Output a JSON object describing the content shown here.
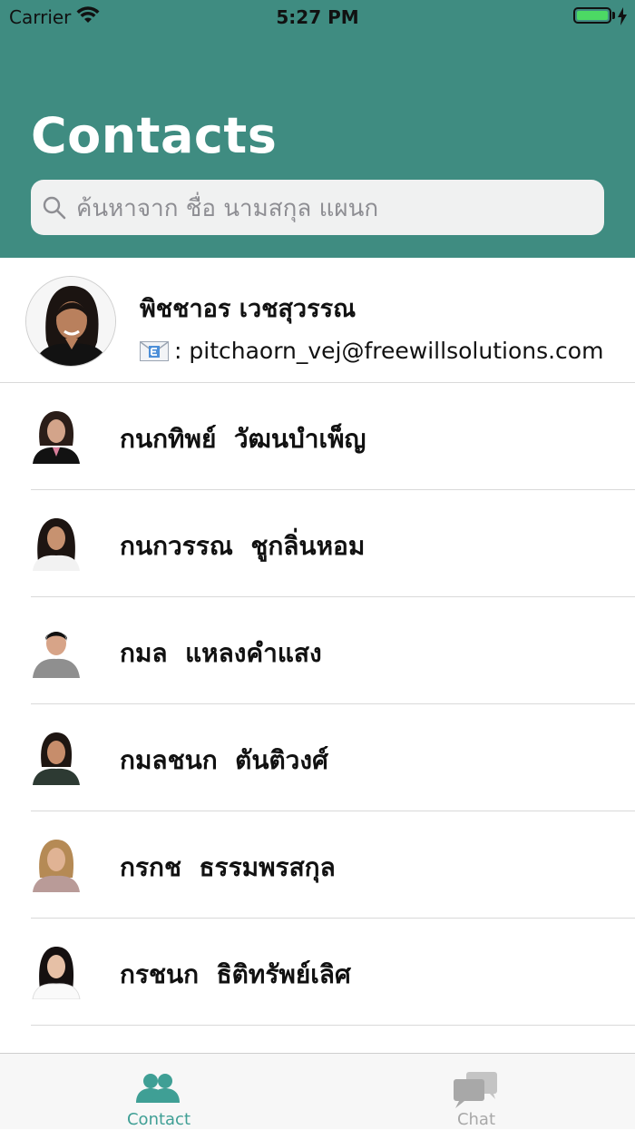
{
  "status_bar": {
    "carrier": "Carrier",
    "time": "5:27 PM",
    "battery_level": 1.0
  },
  "header": {
    "title": "Contacts",
    "background_color": "#3f8c81"
  },
  "search": {
    "placeholder": "ค้นหาจาก ชื่อ นามสกุล แผนก",
    "value": "",
    "icon": "search-icon"
  },
  "current_user": {
    "name": "พิชชาอร เวชสุวรรณ",
    "email_prefix": ": ",
    "email": "pitchaorn_vej@freewillsolutions.com",
    "email_icon": "email-icon"
  },
  "contacts": [
    {
      "name": "กนกทิพย์  วัฒนบำเพ็ญ"
    },
    {
      "name": "กนกวรรณ  ชูกลิ่นหอม"
    },
    {
      "name": "กมล  แหลงคำแสง"
    },
    {
      "name": "กมลชนก  ตันติวงศ์"
    },
    {
      "name": "กรกช  ธรรมพรสกุล"
    },
    {
      "name": "กรชนก  ธิติทรัพย์เลิศ"
    }
  ],
  "tabbar": {
    "tabs": [
      {
        "label": "Contact",
        "icon": "contacts-icon",
        "active": true,
        "color": "#3f9f95"
      },
      {
        "label": "Chat",
        "icon": "chat-icon",
        "active": false,
        "color": "#a8a8a8"
      }
    ]
  }
}
